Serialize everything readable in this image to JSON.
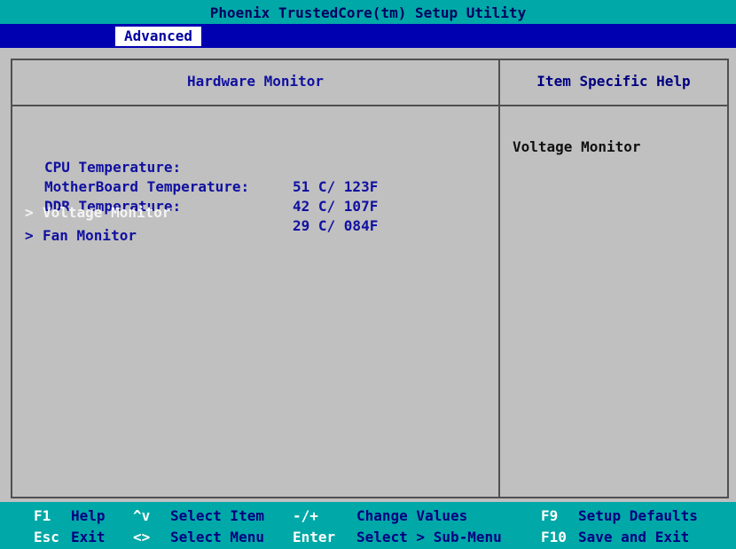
{
  "title": "Phoenix TrustedCore(tm) Setup Utility",
  "menu": {
    "active_tab": "Advanced"
  },
  "main": {
    "header": "Hardware Monitor",
    "readings": [
      {
        "label": "CPU Temperature:",
        "value": "51 C/ 123F"
      },
      {
        "label": "MotherBoard Temperature:",
        "value": "42 C/ 107F"
      },
      {
        "label": "DDR Temperature:",
        "value": "29 C/ 084F"
      }
    ],
    "submenus": [
      {
        "label": "Voltage Monitor",
        "selected": true
      },
      {
        "label": "Fan Monitor",
        "selected": false
      }
    ],
    "arrow_glyph": ">"
  },
  "help": {
    "header": "Item Specific Help",
    "text": "Voltage Monitor"
  },
  "footer": {
    "row1": [
      {
        "key": "F1",
        "desc": "Help"
      },
      {
        "key": "^v",
        "desc": "Select Item"
      },
      {
        "key": "-/+",
        "desc": "Change Values"
      },
      {
        "key": "F9",
        "desc": "Setup Defaults"
      }
    ],
    "row2": [
      {
        "key": "Esc",
        "desc": "Exit"
      },
      {
        "key": "<>",
        "desc": "Select Menu"
      },
      {
        "key": "Enter",
        "desc": "Select > Sub-Menu"
      },
      {
        "key": "F10",
        "desc": "Save and Exit"
      }
    ]
  },
  "colors": {
    "title_bg": "#00a8a8",
    "menu_bg": "#0000b0",
    "panel_bg": "#c0c0c0",
    "text_blue": "#1010a0",
    "selected_text": "#f4f4f4"
  }
}
